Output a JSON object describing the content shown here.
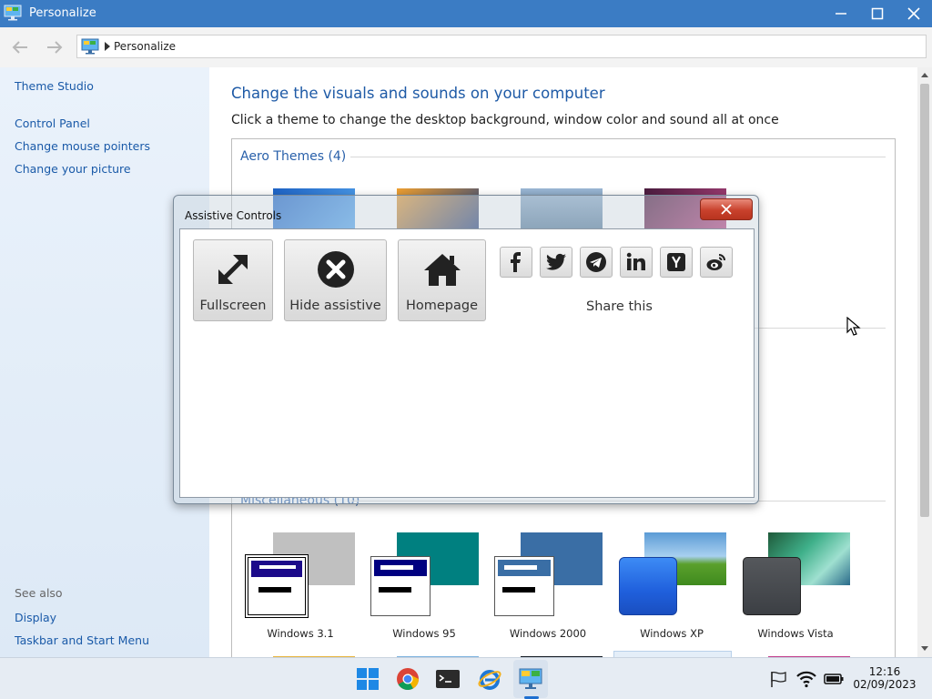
{
  "window": {
    "title": "Personalize"
  },
  "address": {
    "crumb": "Personalize"
  },
  "sidebar": {
    "links": [
      {
        "label": "Theme Studio"
      },
      {
        "label": "Control Panel"
      },
      {
        "label": "Change mouse pointers"
      },
      {
        "label": "Change your picture"
      }
    ],
    "see_also_label": "See also",
    "see_also": [
      {
        "label": "Display"
      },
      {
        "label": "Taskbar and Start Menu"
      }
    ]
  },
  "main": {
    "heading": "Change the visuals and sounds on your computer",
    "subheading": "Click a theme to change the desktop background, window color and sound all at once",
    "aero_group": "Aero Themes (4)",
    "misc_group": "Miscellaneous (10)",
    "misc_themes": [
      {
        "name": "Windows 3.1",
        "bg": "#c0c0c0",
        "accent": "#1c0a8a"
      },
      {
        "name": "Windows 95",
        "bg": "#008080",
        "accent": "#000080"
      },
      {
        "name": "Windows 2000",
        "bg": "#3a6ea5",
        "accent": "#3a6ea5"
      },
      {
        "name": "Windows XP",
        "bg": "#5b9bd5",
        "accent": "#1f5fdc"
      },
      {
        "name": "Windows Vista",
        "bg": "#2a8a6a",
        "accent": "#3c3f44"
      }
    ]
  },
  "assistive": {
    "title": "Assistive Controls",
    "buttons": [
      {
        "label": "Fullscreen",
        "icon": "fullscreen-arrows-icon"
      },
      {
        "label": "Hide assistive",
        "icon": "x-circle-icon"
      },
      {
        "label": "Homepage",
        "icon": "home-icon"
      }
    ],
    "share": [
      {
        "icon": "facebook-icon"
      },
      {
        "icon": "twitter-icon"
      },
      {
        "icon": "telegram-icon"
      },
      {
        "icon": "linkedin-icon"
      },
      {
        "icon": "ycombinator-icon"
      },
      {
        "icon": "weibo-icon"
      }
    ],
    "share_label": "Share this"
  },
  "taskbar": {
    "time": "12:16",
    "date": "02/09/2023"
  },
  "colors": {
    "titlebar": "#3b7cc4",
    "link": "#1a5aa8",
    "heading": "#1e5aa6",
    "close_red": "#c8412c"
  }
}
